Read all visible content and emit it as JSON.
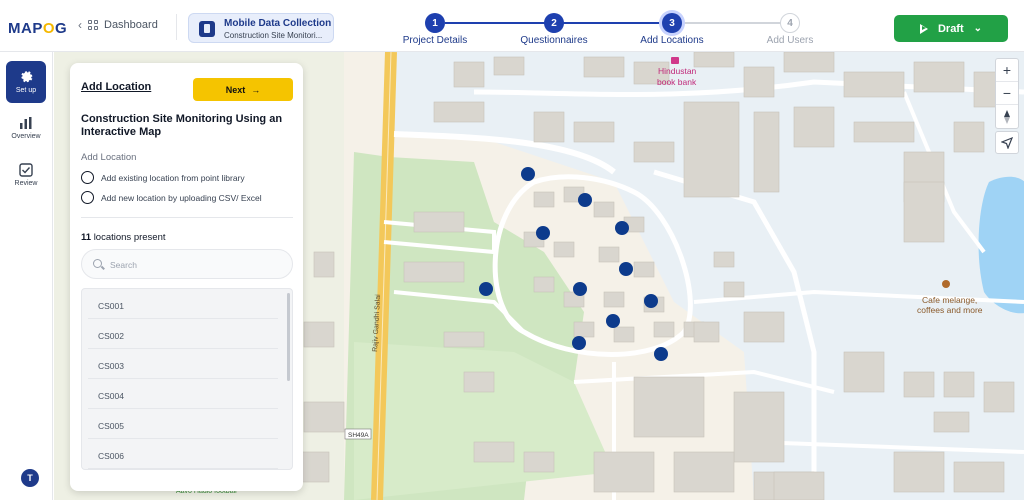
{
  "logo": {
    "part1": "MAP",
    "part2": "O",
    "part3": "G"
  },
  "header": {
    "back_label": "Dashboard",
    "project_title": "Mobile Data Collection",
    "project_subtitle": "Construction Site Monitori...",
    "steps": [
      {
        "number": "1",
        "label": "Project Details",
        "state": "done"
      },
      {
        "number": "2",
        "label": "Questionnaires",
        "state": "done"
      },
      {
        "number": "3",
        "label": "Add Locations",
        "state": "active"
      },
      {
        "number": "4",
        "label": "Add Users",
        "state": "pending"
      }
    ],
    "draft_label": "Draft"
  },
  "sidebar": {
    "items": [
      {
        "label": "Set up",
        "icon": "gear-icon"
      },
      {
        "label": "Overview",
        "icon": "bar-chart-icon"
      },
      {
        "label": "Review",
        "icon": "checkbox-icon"
      }
    ],
    "avatar_initial": "T"
  },
  "panel": {
    "title": "Add Location",
    "next_label": "Next",
    "project_name": "Construction Site Monitoring Using an Interactive Map",
    "section_label": "Add Location",
    "options": [
      "Add existing location from point library",
      "Add new location by uploading CSV/ Excel"
    ],
    "count_number": "11",
    "count_text": "locations present",
    "search_placeholder": "Search",
    "locations": [
      "CS001",
      "CS002",
      "CS003",
      "CS004",
      "CS005",
      "CS006"
    ]
  },
  "map": {
    "labels": {
      "bookbank": "Hindustan book bank",
      "bookbank_line1": "Hindustan",
      "bookbank_line2": "book bank",
      "cafe_line1": "Cafe melange,",
      "cafe_line2": "coffees and more",
      "road": "Rajiv Gandhi Salai",
      "highway": "SH49A",
      "park": "Aavo Hadio football"
    },
    "marker_color": "#0d3b8c",
    "zoom_in": "+",
    "zoom_out": "−"
  },
  "colors": {
    "brand": "#1e3a8a",
    "accent_yellow": "#f5c400",
    "draft_green": "#22a146",
    "park_green": "#cfe6c1",
    "water": "#9fd3f5"
  }
}
